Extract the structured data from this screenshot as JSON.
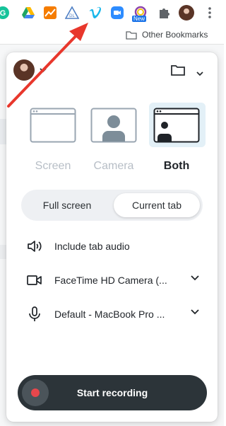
{
  "toolbar": {
    "extensions": [
      {
        "icon": "grammarly-icon",
        "color": "#15c39a"
      },
      {
        "icon": "google-drive-icon",
        "color": "#1fa463"
      },
      {
        "icon": "analytics-icon",
        "color": "#f57c00"
      },
      {
        "icon": "triangle-extension-icon",
        "color": "#4f7fc4"
      },
      {
        "icon": "vimeo-icon",
        "color": "#1ab7ea"
      },
      {
        "icon": "zoom-icon",
        "color": "#2d8cff"
      },
      {
        "icon": "new-extension-icon",
        "color": "#8e44ad"
      },
      {
        "icon": "puzzle-icon",
        "color": "#5f6368"
      },
      {
        "icon": "profile-avatar-icon",
        "color": "#6b3a2a"
      },
      {
        "icon": "more-vertical-icon",
        "color": "#5f6368"
      }
    ],
    "new_badge": "New"
  },
  "bookmarks": {
    "other_label": "Other Bookmarks"
  },
  "annotation": {
    "arrow_color": "#e8372c"
  },
  "popup": {
    "modes": [
      {
        "label": "Screen",
        "icon": "screen-mode-icon",
        "selected": false
      },
      {
        "label": "Camera",
        "icon": "camera-mode-icon",
        "selected": false
      },
      {
        "label": "Both",
        "icon": "both-mode-icon",
        "selected": true
      }
    ],
    "segment": {
      "options": [
        "Full screen",
        "Current tab"
      ],
      "selected": "Current tab"
    },
    "options": [
      {
        "icon": "speaker-icon",
        "label": "Include tab audio",
        "has_dropdown": false
      },
      {
        "icon": "video-camera-icon",
        "label": "FaceTime HD Camera (...",
        "has_dropdown": true
      },
      {
        "icon": "microphone-icon",
        "label": "Default - MacBook Pro ...",
        "has_dropdown": true
      }
    ],
    "start_button": "Start recording",
    "colors": {
      "selected_mode_bg": "#e3f0f7",
      "start_button_bg": "#2c3439",
      "record_dot": "#e8474c"
    }
  }
}
